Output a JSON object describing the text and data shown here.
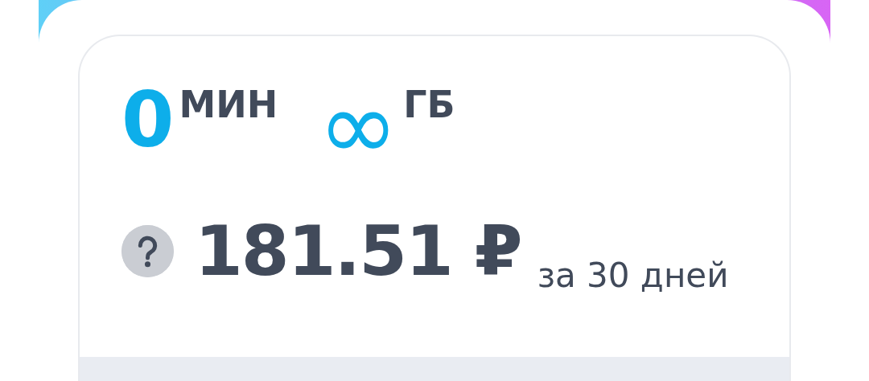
{
  "allowances": [
    {
      "value": "0",
      "unit": "МИН"
    },
    {
      "value": "∞",
      "unit": "ГБ"
    }
  ],
  "price": {
    "amount": "181.51 ₽",
    "period": "за 30 дней"
  }
}
